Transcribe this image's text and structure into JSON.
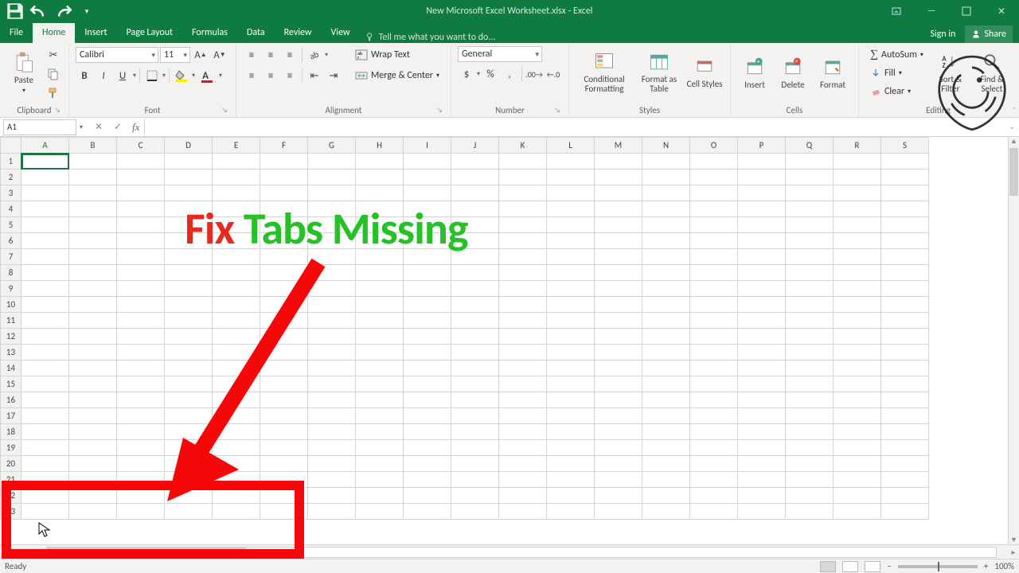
{
  "titlebar": {
    "title": "New Microsoft Excel Worksheet.xlsx - Excel"
  },
  "menubar": {
    "tabs": [
      "File",
      "Home",
      "Insert",
      "Page Layout",
      "Formulas",
      "Data",
      "Review",
      "View"
    ],
    "active": "Home",
    "tell": "Tell me what you want to do...",
    "signin": "Sign in",
    "share": "Share"
  },
  "ribbon": {
    "clipboard": {
      "paste": "Paste",
      "label": "Clipboard"
    },
    "font": {
      "name": "Calibri",
      "size": "11",
      "label": "Font",
      "bold": "B",
      "italic": "I",
      "underline": "U"
    },
    "alignment": {
      "wrap": "Wrap Text",
      "merge": "Merge & Center",
      "label": "Alignment"
    },
    "number": {
      "format": "General",
      "label": "Number"
    },
    "styles": {
      "cond": "Conditional Formatting",
      "fat": "Format as Table",
      "cell": "Cell Styles",
      "label": "Styles"
    },
    "cells": {
      "insert": "Insert",
      "delete": "Delete",
      "format": "Format",
      "label": "Cells"
    },
    "editing": {
      "autosum": "AutoSum",
      "fill": "Fill",
      "clear": "Clear",
      "sort": "Sort & Filter",
      "find": "Find & Select",
      "label": "Editing"
    }
  },
  "namebox": "A1",
  "columns": [
    "A",
    "B",
    "C",
    "D",
    "E",
    "F",
    "G",
    "H",
    "I",
    "J",
    "K",
    "L",
    "M",
    "N",
    "O",
    "P",
    "Q",
    "R",
    "S"
  ],
  "rows": [
    "1",
    "2",
    "3",
    "4",
    "5",
    "6",
    "7",
    "8",
    "9",
    "10",
    "11",
    "12",
    "13",
    "14",
    "15",
    "16",
    "17",
    "18",
    "19",
    "20",
    "21",
    "22",
    "23"
  ],
  "status": {
    "ready": "Ready",
    "zoom": "100%"
  },
  "overlay": {
    "fix": "Fix ",
    "rest": "Tabs Missing"
  }
}
